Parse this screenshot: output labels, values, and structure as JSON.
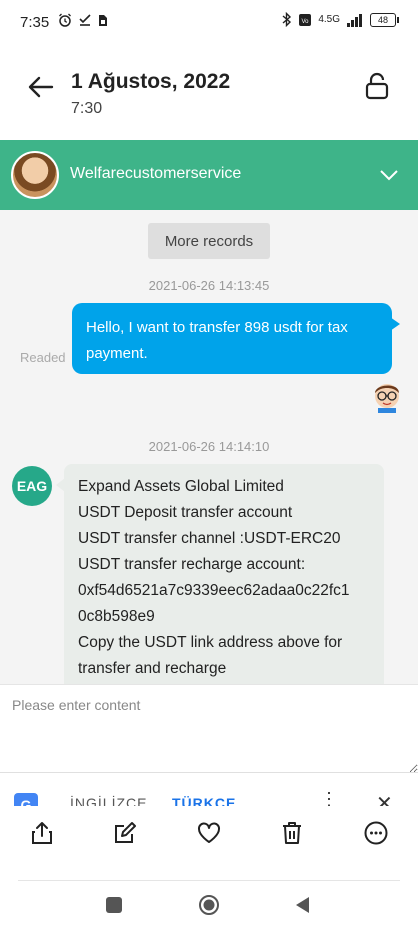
{
  "status_bar": {
    "time": "7:35",
    "network": "4.5G",
    "battery": "48"
  },
  "header": {
    "title": "1 Ağustos, 2022",
    "subtitle": "7:30"
  },
  "chat": {
    "contact_name": "Welfarecustomerservice",
    "more_records_label": "More records",
    "messages": [
      {
        "timestamp": "2021-06-26 14:13:45",
        "direction": "outgoing",
        "status": "Readed",
        "text": "Hello, I want to transfer 898 usdt for tax payment."
      },
      {
        "timestamp": "2021-06-26 14:14:10",
        "direction": "incoming",
        "sender_avatar": "EAG",
        "lines": [
          "Expand Assets Global Limited",
          "USDT Deposit transfer account",
          "USDT transfer channel :USDT-ERC20",
          "USDT transfer recharge account:",
          "0xf54d6521a7c9339eec62adaa0c22fc1",
          "0c8b598e9",
          "Copy the USDT link address above for",
          "transfer and recharge"
        ]
      }
    ]
  },
  "input": {
    "placeholder": "Please enter content"
  },
  "translate_bar": {
    "source_language": "İNGİLİZCE",
    "target_language": "TÜRKÇE"
  },
  "colors": {
    "chat_bar": "#3eb489",
    "outgoing_bubble": "#00a3ea",
    "incoming_bubble": "#e9edea"
  }
}
